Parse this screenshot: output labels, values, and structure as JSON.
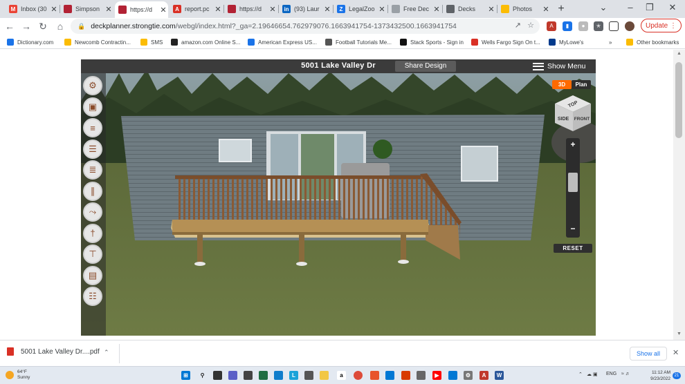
{
  "tabs": [
    {
      "label": "Inbox (30",
      "icon": "gmail-icon",
      "color": "#ea4335",
      "glyph": "M"
    },
    {
      "label": "Simpson",
      "icon": "simpson-flag-icon",
      "color": "#b22234",
      "glyph": ""
    },
    {
      "label": "https://d",
      "icon": "deckplanner-flag-icon",
      "color": "#b22234",
      "glyph": "",
      "active": true
    },
    {
      "label": "report.pc",
      "icon": "pdf-icon",
      "color": "#d93025",
      "glyph": "A"
    },
    {
      "label": "https://d",
      "icon": "flag-icon",
      "color": "#b22234",
      "glyph": ""
    },
    {
      "label": "(93) Laur",
      "icon": "linkedin-icon",
      "color": "#0a66c2",
      "glyph": "in"
    },
    {
      "label": "LegalZoo",
      "icon": "legalzoom-icon",
      "color": "#1a73e8",
      "glyph": "Z"
    },
    {
      "label": "Free Dec",
      "icon": "free-deck-icon",
      "color": "#9aa0a6",
      "glyph": ""
    },
    {
      "label": "Decks",
      "icon": "globe-icon",
      "color": "#5f6368",
      "glyph": ""
    },
    {
      "label": "Photos",
      "icon": "photos-icon",
      "color": "#fbbc04",
      "glyph": ""
    }
  ],
  "address": {
    "host": "deckplanner.strongtie.com",
    "path": "/webgl/index.html?_ga=2.19646654.762979076.1663941754-1373432500.1663941754"
  },
  "update_label": "Update",
  "bookmarks": [
    {
      "label": "Dictionary.com",
      "color": "#1a73e8"
    },
    {
      "label": "Newcomb Contractin...",
      "color": "#fbbc04"
    },
    {
      "label": "SMS",
      "color": "#fbbc04"
    },
    {
      "label": "amazon.com Online S...",
      "color": "#222222"
    },
    {
      "label": "American Express US...",
      "color": "#1a73e8"
    },
    {
      "label": "Football Tutorials Me...",
      "color": "#555555"
    },
    {
      "label": "Stack Sports - Sign in",
      "color": "#111111"
    },
    {
      "label": "Wells Fargo Sign On t...",
      "color": "#d93025"
    },
    {
      "label": "MyLowe's",
      "color": "#013a8c"
    }
  ],
  "other_bookmarks": "Other bookmarks",
  "app": {
    "title": "5001 Lake Valley Dr",
    "share_label": "Share Design",
    "menu_label": "Show Menu",
    "view_3d": "3D",
    "view_plan": "Plan",
    "cube_top": "TOP",
    "cube_side": "SIDE",
    "cube_front": "FRONT",
    "zoom_in": "+",
    "zoom_out": "−",
    "zoom_level": 0.6,
    "reset_label": "RESET",
    "tools": [
      {
        "name": "settings-tool",
        "glyph": "⚙"
      },
      {
        "name": "deck-shape-tool",
        "glyph": "▣"
      },
      {
        "name": "stairs-tool",
        "glyph": "≡"
      },
      {
        "name": "boards-tool",
        "glyph": "☰"
      },
      {
        "name": "joists-tool",
        "glyph": "≣"
      },
      {
        "name": "railing-tool",
        "glyph": "∥"
      },
      {
        "name": "connector-tool",
        "glyph": "⤳"
      },
      {
        "name": "fastener-tool",
        "glyph": "†"
      },
      {
        "name": "post-tool",
        "glyph": "⊤"
      },
      {
        "name": "furniture-tool",
        "glyph": "▤"
      },
      {
        "name": "report-tool",
        "glyph": "☷"
      }
    ]
  },
  "download": {
    "filename": "5001 Lake Valley Dr....pdf",
    "show_all": "Show all"
  },
  "taskbar": {
    "temp": "64°F",
    "condition": "Sunny",
    "lang": "ENG",
    "time": "11:12 AM",
    "date": "9/23/2022",
    "notifications": "21"
  }
}
